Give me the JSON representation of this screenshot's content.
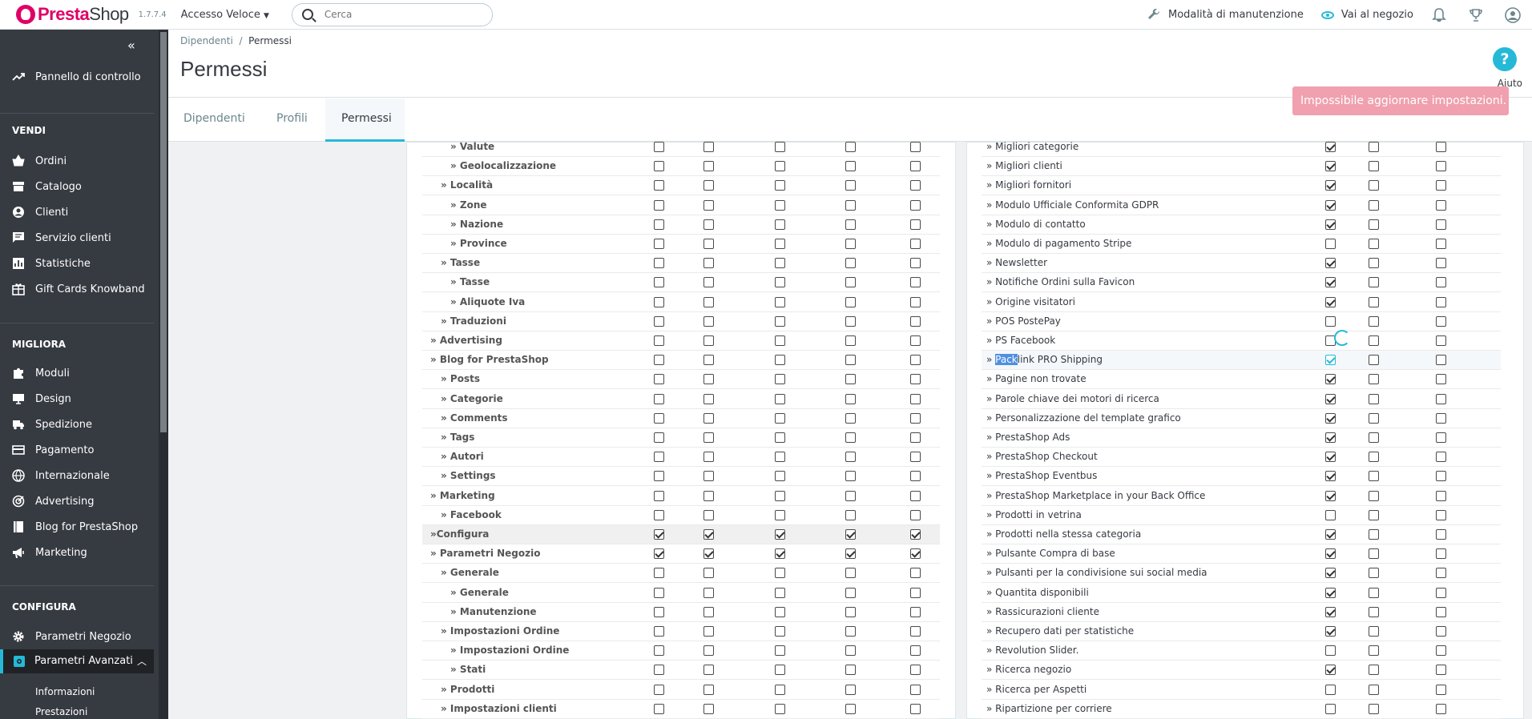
{
  "header": {
    "brand_a": "Presta",
    "brand_b": "Shop",
    "version": "1.7.7.4",
    "quick_access": "Accesso Veloce",
    "search_placeholder": "Cerca",
    "maintenance": "Modalità di manutenzione",
    "visit_shop": "Vai al negozio"
  },
  "sidebar": {
    "dashboard": "Pannello di controllo",
    "sections": {
      "sell": "VENDI",
      "improve": "MIGLIORA",
      "configure": "CONFIGURA"
    },
    "sell_items": [
      "Ordini",
      "Catalogo",
      "Clienti",
      "Servizio clienti",
      "Statistiche",
      "Gift Cards Knowband"
    ],
    "improve_items": [
      "Moduli",
      "Design",
      "Spedizione",
      "Pagamento",
      "Internazionale",
      "Advertising",
      "Blog for PrestaShop",
      "Marketing"
    ],
    "configure_items": [
      "Parametri Negozio",
      "Parametri Avanzati"
    ],
    "sub_items": [
      "Informazioni",
      "Prestazioni"
    ]
  },
  "page": {
    "breadcrumb": [
      "Dipendenti",
      "/",
      "Permessi"
    ],
    "title": "Permessi",
    "tabs": [
      "Dipendenti",
      "Profili",
      "Permessi"
    ],
    "help": "Aiuto",
    "alert": "Impossibile aggiornare impostazioni. ×"
  },
  "left_rows": [
    {
      "label": "» Valute",
      "checks": [
        0,
        0,
        0,
        0,
        0
      ]
    },
    {
      "label": "» Geolocalizzazione",
      "checks": [
        0,
        0,
        0,
        0,
        0
      ]
    },
    {
      "label": "» Località",
      "checks": [
        0,
        0,
        0,
        0,
        0
      ]
    },
    {
      "label": "» Zone",
      "checks": [
        0,
        0,
        0,
        0,
        0
      ]
    },
    {
      "label": "» Nazione",
      "checks": [
        0,
        0,
        0,
        0,
        0
      ]
    },
    {
      "label": "» Province",
      "checks": [
        0,
        0,
        0,
        0,
        0
      ]
    },
    {
      "label": "» Tasse",
      "checks": [
        0,
        0,
        0,
        0,
        0
      ]
    },
    {
      "label": "» Tasse",
      "checks": [
        0,
        0,
        0,
        0,
        0
      ]
    },
    {
      "label": "» Aliquote Iva",
      "checks": [
        0,
        0,
        0,
        0,
        0
      ]
    },
    {
      "label": "» Traduzioni",
      "checks": [
        0,
        0,
        0,
        0,
        0
      ]
    },
    {
      "label": "» Advertising",
      "checks": [
        0,
        0,
        0,
        0,
        0
      ]
    },
    {
      "label": "» Blog for PrestaShop",
      "checks": [
        0,
        0,
        0,
        0,
        0
      ]
    },
    {
      "label": "» Posts",
      "checks": [
        0,
        0,
        0,
        0,
        0
      ]
    },
    {
      "label": "» Categorie",
      "checks": [
        0,
        0,
        0,
        0,
        0
      ]
    },
    {
      "label": "» Comments",
      "checks": [
        0,
        0,
        0,
        0,
        0
      ]
    },
    {
      "label": "» Tags",
      "checks": [
        0,
        0,
        0,
        0,
        0
      ]
    },
    {
      "label": "» Autori",
      "checks": [
        0,
        0,
        0,
        0,
        0
      ]
    },
    {
      "label": "» Settings",
      "checks": [
        0,
        0,
        0,
        0,
        0
      ]
    },
    {
      "label": "» Marketing",
      "checks": [
        0,
        0,
        0,
        0,
        0
      ]
    },
    {
      "label": "» Facebook",
      "checks": [
        0,
        0,
        0,
        0,
        0
      ]
    },
    {
      "label": "»Configura",
      "checks": [
        1,
        1,
        1,
        1,
        1
      ]
    },
    {
      "label": "» Parametri Negozio",
      "checks": [
        1,
        1,
        1,
        1,
        1
      ]
    },
    {
      "label": "» Generale",
      "checks": [
        0,
        0,
        0,
        0,
        0
      ]
    },
    {
      "label": "» Generale",
      "checks": [
        0,
        0,
        0,
        0,
        0
      ]
    },
    {
      "label": "» Manutenzione",
      "checks": [
        0,
        0,
        0,
        0,
        0
      ]
    },
    {
      "label": "» Impostazioni Ordine",
      "checks": [
        0,
        0,
        0,
        0,
        0
      ]
    },
    {
      "label": "» Impostazioni Ordine",
      "checks": [
        0,
        0,
        0,
        0,
        0
      ]
    },
    {
      "label": "» Stati",
      "checks": [
        0,
        0,
        0,
        0,
        0
      ]
    },
    {
      "label": "» Prodotti",
      "checks": [
        0,
        0,
        0,
        0,
        0
      ]
    },
    {
      "label": "» Impostazioni clienti",
      "checks": [
        0,
        0,
        0,
        0,
        0
      ]
    }
  ],
  "right_rows": [
    {
      "label": "» Migliori categorie",
      "checks": [
        1,
        0,
        0
      ]
    },
    {
      "label": "» Migliori clienti",
      "checks": [
        1,
        0,
        0
      ]
    },
    {
      "label": "» Migliori fornitori",
      "checks": [
        1,
        0,
        0
      ]
    },
    {
      "label": "» Modulo Ufficiale Conformita GDPR",
      "checks": [
        1,
        0,
        0
      ]
    },
    {
      "label": "» Modulo di contatto",
      "checks": [
        1,
        0,
        0
      ]
    },
    {
      "label": "» Modulo di pagamento Stripe",
      "checks": [
        0,
        0,
        0
      ]
    },
    {
      "label": "» Newsletter",
      "checks": [
        1,
        0,
        0
      ]
    },
    {
      "label": "» Notifiche Ordini sulla Favicon",
      "checks": [
        1,
        0,
        0
      ]
    },
    {
      "label": "» Origine visitatori",
      "checks": [
        1,
        0,
        0
      ]
    },
    {
      "label": "» POS PostePay",
      "checks": [
        0,
        0,
        0
      ]
    },
    {
      "label": "» PS Facebook",
      "checks": [
        0,
        0,
        0
      ]
    },
    {
      "label": "» Packlink PRO Shipping",
      "checks": [
        1,
        0,
        0
      ],
      "selected": "Pack",
      "rest": "link PRO Shipping"
    },
    {
      "label": "» Pagine non trovate",
      "checks": [
        1,
        0,
        0
      ]
    },
    {
      "label": "» Parole chiave dei motori di ricerca",
      "checks": [
        1,
        0,
        0
      ]
    },
    {
      "label": "» Personalizzazione del template grafico",
      "checks": [
        1,
        0,
        0
      ]
    },
    {
      "label": "» PrestaShop Ads",
      "checks": [
        1,
        0,
        0
      ]
    },
    {
      "label": "» PrestaShop Checkout",
      "checks": [
        1,
        0,
        0
      ]
    },
    {
      "label": "» PrestaShop Eventbus",
      "checks": [
        1,
        0,
        0
      ]
    },
    {
      "label": "» PrestaShop Marketplace in your Back Office",
      "checks": [
        1,
        0,
        0
      ]
    },
    {
      "label": "» Prodotti in vetrina",
      "checks": [
        0,
        0,
        0
      ]
    },
    {
      "label": "» Prodotti nella stessa categoria",
      "checks": [
        1,
        0,
        0
      ]
    },
    {
      "label": "» Pulsante Compra di base",
      "checks": [
        1,
        0,
        0
      ]
    },
    {
      "label": "» Pulsanti per la condivisione sui social media",
      "checks": [
        1,
        0,
        0
      ]
    },
    {
      "label": "» Quantita disponibili",
      "checks": [
        1,
        0,
        0
      ]
    },
    {
      "label": "» Rassicurazioni cliente",
      "checks": [
        1,
        0,
        0
      ]
    },
    {
      "label": "» Recupero dati per statistiche",
      "checks": [
        1,
        0,
        0
      ]
    },
    {
      "label": "» Revolution Slider.",
      "checks": [
        0,
        0,
        0
      ]
    },
    {
      "label": "» Ricerca negozio",
      "checks": [
        1,
        0,
        0
      ]
    },
    {
      "label": "» Ricerca per Aspetti",
      "checks": [
        0,
        0,
        0
      ]
    },
    {
      "label": "» Ripartizione per corriere",
      "checks": [
        0,
        0,
        0
      ]
    }
  ]
}
